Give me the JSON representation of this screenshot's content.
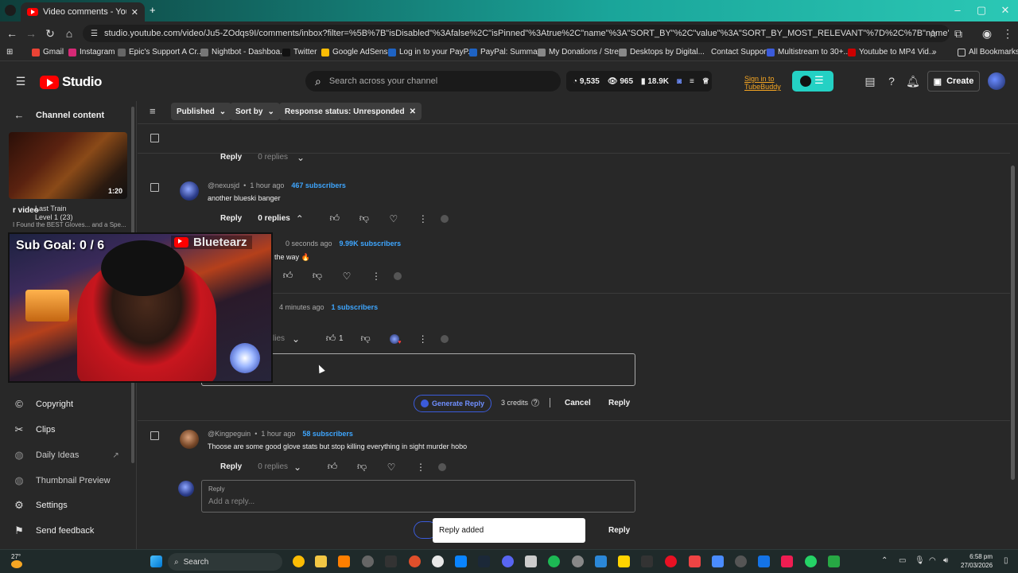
{
  "browser": {
    "tab_title": "Video comments - YouTube St",
    "url": "studio.youtube.com/video/Ju5-ZOdqs9I/comments/inbox?filter=%5B%7B\"isDisabled\"%3Afalse%2C\"isPinned\"%3Atrue%2C\"name\"%3A\"SORT_BY\"%2C\"value\"%3A\"SORT_BY_MOST_RELEVANT\"%7D%2C%7B\"name\"%3A\"ENGAGED_STATUS\"%2C\"value\"...",
    "bookmarks": [
      "Gmail",
      "Instagram",
      "Epic's Support A Cr...",
      "Nightbot - Dashboa...",
      "Twitter",
      "Google AdSense",
      "Log in to your PayP...",
      "PayPal: Summary",
      "My Donations / Stre...",
      "Desktops by Digital...",
      "Contact Support",
      "Multistream to 30+...",
      "Youtube to MP4 Vid...",
      "All Bookmarks"
    ],
    "bookmark_more": "»"
  },
  "header": {
    "logo_text": "Studio",
    "search_placeholder": "Search across your channel",
    "stats": {
      "s1": "9,535",
      "s2": "965",
      "s3": "18.9K"
    },
    "tubebuddy_line1": "Sign in to",
    "tubebuddy_line2": "TubeBuddy",
    "create_label": "Create"
  },
  "sidebar": {
    "back_label": "Channel content",
    "thumb_duration": "1:20",
    "video_label": "r video",
    "song_title": "Last Train",
    "song_level": "Level 1",
    "song_count": "(23)",
    "video_title": "I Found the BEST Gloves... and a Spe...",
    "items": [
      {
        "label": "Copyright"
      },
      {
        "label": "Clips"
      },
      {
        "label": "Daily Ideas"
      },
      {
        "label": "Thumbnail Preview"
      },
      {
        "label": "Settings"
      },
      {
        "label": "Send feedback"
      }
    ]
  },
  "overlay": {
    "sub_goal": "Sub Goal: 0 / 6",
    "channel_name": "Bluetearz"
  },
  "filters": {
    "published": "Published",
    "sort_by": "Sort by",
    "response_status": "Response status: Unresponded"
  },
  "comments": {
    "c0": {
      "reply_label": "Reply",
      "replies": "0 replies"
    },
    "c1": {
      "handle": "@nexusjd",
      "time": "1 hour ago",
      "subs": "467 subscribers",
      "text": "another blueski banger",
      "reply_label": "Reply",
      "replies": "0 replies"
    },
    "c2": {
      "time": "0 seconds ago",
      "subs": "9.99K subscribers",
      "text": "the way 🔥"
    },
    "c3": {
      "time": "4 minutes ago",
      "subs": "1 subscribers",
      "replies": "lies",
      "likes": "1"
    },
    "reply_editor": {
      "generate_label": "Generate Reply",
      "credits": "3 credits",
      "cancel_label": "Cancel",
      "reply_label": "Reply"
    },
    "c4": {
      "handle": "@Kingpeguin",
      "time": "1 hour ago",
      "subs": "58 subscribers",
      "text": "Thoose are some good glove stats but stop killing everything in sight murder hobo",
      "reply_label": "Reply",
      "replies": "0 replies"
    },
    "reply_box2": {
      "label": "Reply",
      "placeholder": "Add a reply...",
      "reply_label": "Reply"
    }
  },
  "toast": {
    "text": "Reply added"
  },
  "taskbar": {
    "weather": "27°",
    "search_label": "Search",
    "time": "6:58 pm",
    "date": "27/03/2026"
  },
  "colors": {
    "accent_blue": "#3ea6ff",
    "brand_red": "#ff0000",
    "tubebuddy_teal": "#24d1c4"
  }
}
